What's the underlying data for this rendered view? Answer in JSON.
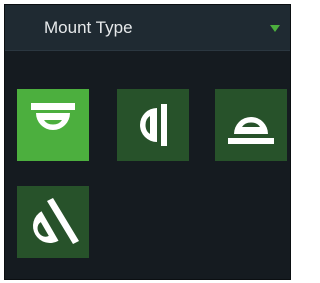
{
  "panel": {
    "title": "Mount Type",
    "expand_icon": "triangle-down-icon",
    "accent_color": "#4caf3e",
    "tile_color": "#27522a",
    "background_color": "#151b20"
  },
  "mount_options": [
    {
      "icon": "ceiling-mount-icon",
      "selected": true
    },
    {
      "icon": "wall-mount-icon",
      "selected": false
    },
    {
      "icon": "desk-mount-icon",
      "selected": false
    },
    {
      "icon": "tilted-wall-mount-icon",
      "selected": false
    }
  ]
}
